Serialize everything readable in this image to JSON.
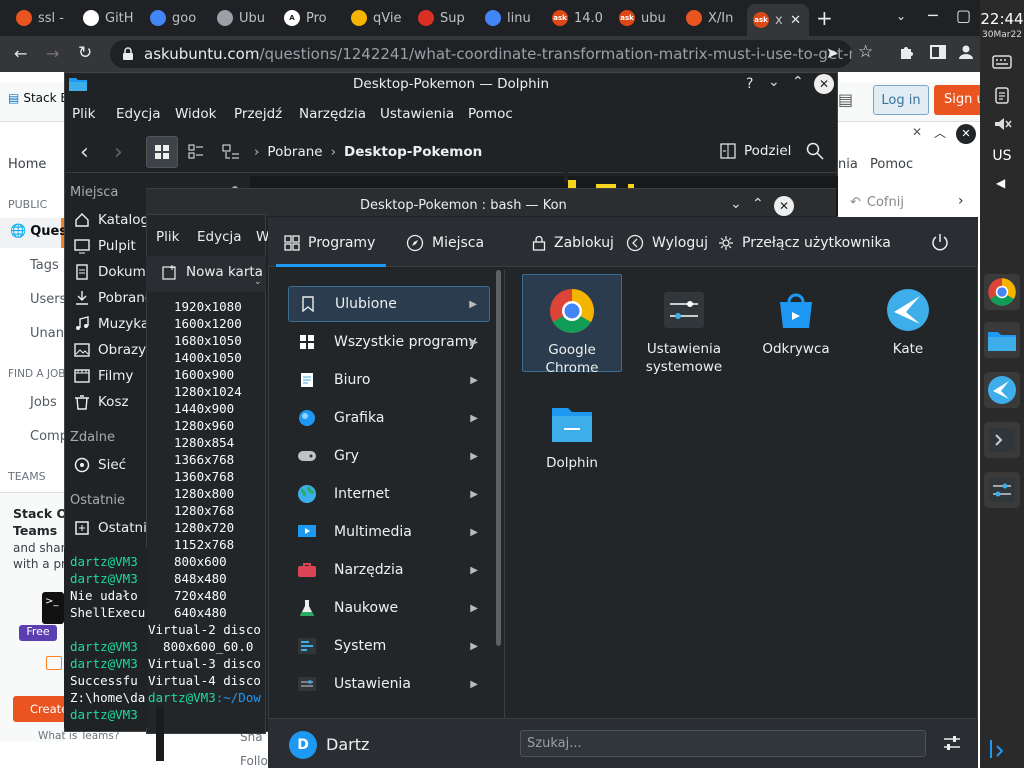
{
  "browser": {
    "tabs": [
      {
        "label": "ssl -",
        "icon": "ubuntu-icon",
        "color": "#e95420"
      },
      {
        "label": "GitH",
        "icon": "github-icon",
        "color": "#ffffff"
      },
      {
        "label": "goo",
        "icon": "google-icon",
        "color": "#4285f4"
      },
      {
        "label": "Ubu",
        "icon": "globe-icon",
        "color": "#9aa0a6"
      },
      {
        "label": "Pro",
        "icon": "a-icon",
        "color": "#ffffff"
      },
      {
        "label": "qVie",
        "icon": "qview-icon",
        "color": "#f4b400"
      },
      {
        "label": "Sup",
        "icon": "support-icon",
        "color": "#d93025"
      },
      {
        "label": "linu",
        "icon": "google-icon",
        "color": "#4285f4"
      },
      {
        "label": "14.0",
        "icon": "askubuntu-icon",
        "color": "#dd4814"
      },
      {
        "label": "ubu",
        "icon": "askubuntu-icon",
        "color": "#dd4814"
      },
      {
        "label": "X/In",
        "icon": "ubuntu-icon",
        "color": "#e95420"
      },
      {
        "label": "x",
        "icon": "askubuntu-icon",
        "color": "#dd4814",
        "active": true
      }
    ],
    "new_tab": "+",
    "url_host": "askubuntu.com",
    "url_path": "/questions/1242241/what-coordinate-transformation-matrix-must-i-use-to-get-my-t..."
  },
  "system": {
    "time": "22:44",
    "date": "30Mar22",
    "keyboard_layout": "US"
  },
  "askubuntu": {
    "logo": "Stack E",
    "login": "Log in",
    "signup": "Sign u",
    "nav": [
      "Home",
      "PUBLIC",
      "Quest",
      "Tags",
      "Users",
      "Unans",
      "FIND A JOB",
      "Jobs",
      "Comp",
      "TEAMS"
    ],
    "teams_title": "Stack Ov",
    "teams_sub": "Teams",
    "teams_text1": "and shar",
    "teams_text2": "with a pri",
    "free": "Free",
    "create": "Create",
    "what_teams": "What is Teams?",
    "right_menu_help": "nia",
    "right_menu_pomoc": "Pomoc",
    "cofnij": "Cofnij",
    "share": "Sha",
    "follow": "Follo"
  },
  "dolphin": {
    "title": "Desktop-Pokemon — Dolphin",
    "menu": [
      "Plik",
      "Edycja",
      "Widok",
      "Przejdź",
      "Narzędzia",
      "Ustawienia",
      "Pomoc"
    ],
    "breadcrumb_parent": "Pobrane",
    "breadcrumb_current": "Desktop-Pokemon",
    "split": "Podziel",
    "places_header": "Miejsca",
    "places": [
      "Katalog",
      "Pulpit",
      "Dokume",
      "Pobrane",
      "Muzyka",
      "Obrazy",
      "Filmy",
      "Kosz"
    ],
    "remote_header": "Zdalne",
    "remote": [
      "Sieć"
    ],
    "recent_header": "Ostatnie",
    "recent": [
      "Ostatnie"
    ]
  },
  "konsole": {
    "title": "Desktop-Pokemon : bash — Kon",
    "menu": [
      "Plik",
      "Edycja",
      "W"
    ],
    "new_tab": "Nowa karta",
    "modes": [
      "1920x1080",
      "1600x1200",
      "1680x1050",
      "1400x1050",
      "1600x900",
      "1280x1024",
      "1440x900",
      "1280x960",
      "1280x854",
      "1366x768",
      "1360x768",
      "1280x800",
      "1280x768",
      "1280x720",
      "1152x768",
      "800x600",
      "848x480",
      "720x480",
      "640x480"
    ],
    "virtual2": "Virtual-2 disco",
    "virtual2_mode": "  800x600_60.0",
    "virtual3": "Virtual-3 disco",
    "virtual4": "Virtual-4 disco",
    "left_lines": [
      {
        "text": "dartz@VM3",
        "prompt": true
      },
      {
        "text": "dartz@VM3",
        "prompt": true
      },
      {
        "text": "Nie udało",
        "prompt": false
      },
      {
        "text": "ShellExecu",
        "prompt": false
      },
      {
        "text": "",
        "prompt": false
      },
      {
        "text": "dartz@VM3",
        "prompt": true
      },
      {
        "text": "dartz@VM3",
        "prompt": true
      },
      {
        "text": "Successfu",
        "prompt": false
      },
      {
        "text": "Z:\\home\\da",
        "prompt": false
      },
      {
        "text": "dartz@VM3",
        "prompt": true
      }
    ],
    "last_prompt_user": "dartz@VM3",
    "last_prompt_path": ":~/Dow"
  },
  "launcher": {
    "tabs": {
      "programs": "Programy",
      "places": "Miejsca"
    },
    "actions": {
      "lock": "Zablokuj",
      "logout": "Wyloguj",
      "switch_user": "Przełącz użytkownika"
    },
    "categories": [
      {
        "label": "Ulubione",
        "icon": "bookmark-icon",
        "color": "#2a2e32",
        "selected": true
      },
      {
        "label": "Wszystkie programy",
        "icon": "grid-icon",
        "color": "#1d99f3"
      },
      {
        "label": "Biuro",
        "icon": "office-icon",
        "color": "#3daee9"
      },
      {
        "label": "Grafika",
        "icon": "graphics-icon",
        "color": "#1d99f3"
      },
      {
        "label": "Gry",
        "icon": "gamepad-icon",
        "color": "#7f8c8d"
      },
      {
        "label": "Internet",
        "icon": "globe-icon",
        "color": "#27ae60"
      },
      {
        "label": "Multimedia",
        "icon": "multimedia-icon",
        "color": "#1d99f3"
      },
      {
        "label": "Narzędzia",
        "icon": "toolbox-icon",
        "color": "#da4453"
      },
      {
        "label": "Naukowe",
        "icon": "flask-icon",
        "color": "#95a5a6"
      },
      {
        "label": "System",
        "icon": "system-icon",
        "color": "#3daee9"
      },
      {
        "label": "Ustawienia",
        "icon": "settings-icon",
        "color": "#4d5257"
      }
    ],
    "apps": [
      {
        "label": "Google Chrome",
        "line1": "Google",
        "line2": "Chrome",
        "icon": "chrome-icon",
        "selected": true
      },
      {
        "label": "Ustawienia systemowe",
        "line1": "Ustawienia",
        "line2": "systemowe",
        "icon": "system-settings-icon"
      },
      {
        "label": "Odkrywca",
        "line1": "Odkrywca",
        "line2": "",
        "icon": "discover-icon"
      },
      {
        "label": "Kate",
        "line1": "Kate",
        "line2": "",
        "icon": "kate-icon"
      },
      {
        "label": "Dolphin",
        "line1": "Dolphin",
        "line2": "",
        "icon": "dolphin-icon"
      }
    ],
    "user": "Dartz",
    "user_initial": "D",
    "search_placeholder": "Szukaj..."
  }
}
